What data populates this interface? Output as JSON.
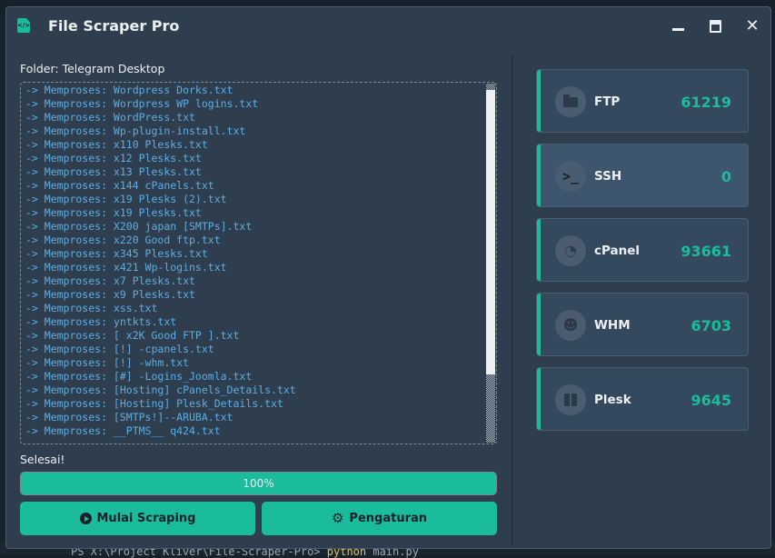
{
  "window": {
    "title": "File Scraper Pro",
    "app_icon_text": "</>",
    "close_glyph": "✕"
  },
  "main": {
    "folder_label": "Folder: Telegram Desktop",
    "log_lines": [
      "-> Memproses: Wordpress Dorks.txt",
      "-> Memproses: Wordpress WP logins.txt",
      "-> Memproses: WordPress.txt",
      "-> Memproses: Wp-plugin-install.txt",
      "-> Memproses: x110 Plesks.txt",
      "-> Memproses: x12 Plesks.txt",
      "-> Memproses: x13 Plesks.txt",
      "-> Memproses: x144 cPanels.txt",
      "-> Memproses: x19 Plesks (2).txt",
      "-> Memproses: x19 Plesks.txt",
      "-> Memproses: X200 japan [SMTPs].txt",
      "-> Memproses: x220 Good ftp.txt",
      "-> Memproses: x345 Plesks.txt",
      "-> Memproses: x421 Wp-logins.txt",
      "-> Memproses: x7 Plesks.txt",
      "-> Memproses: x9 Plesks.txt",
      "-> Memproses: xss.txt",
      "-> Memproses: yntkts.txt",
      "-> Memproses: [ x2K Good FTP ].txt",
      "-> Memproses: [!] -cpanels.txt",
      "-> Memproses: [!] -whm.txt",
      "-> Memproses: [#] -Logins_Joomla.txt",
      "-> Memproses: [Hosting] cPanels_Details.txt",
      "-> Memproses: [Hosting] Plesk_Details.txt",
      "-> Memproses: [SMTPs!]--ARUBA.txt",
      "-> Memproses: __PTMS__ q424.txt"
    ],
    "status_text": "Selesai!",
    "progress": {
      "value": 100,
      "label": "100%"
    },
    "start_button": "Mulai Scraping",
    "settings_button": "Pengaturan"
  },
  "stats": [
    {
      "label": "FTP",
      "value": "61219",
      "icon": "folder-icon"
    },
    {
      "label": "SSH",
      "value": "0",
      "icon": "terminal-icon"
    },
    {
      "label": "cPanel",
      "value": "93661",
      "icon": "dashboard-icon"
    },
    {
      "label": "WHM",
      "value": "6703",
      "icon": "users-cog-icon"
    },
    {
      "label": "Plesk",
      "value": "9645",
      "icon": "plesk-icon"
    }
  ],
  "background": {
    "terminal_text_prefix": "PS X:\\Project Kliver\\File-Scraper-Pro> ",
    "terminal_command": "python",
    "terminal_text_suffix": " main.py"
  },
  "colors": {
    "accent": "#1abc9c",
    "panel": "#2e3e4e",
    "card": "#34495e",
    "log_text": "#5dade2",
    "text": "#ecf0f1"
  }
}
